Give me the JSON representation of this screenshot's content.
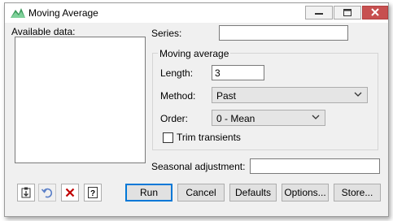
{
  "window": {
    "title": "Moving Average"
  },
  "available_data": {
    "label": "Available data:"
  },
  "series": {
    "label": "Series:",
    "value": ""
  },
  "moving_average": {
    "group_label": "Moving average",
    "length_label": "Length:",
    "length_value": "3",
    "method_label": "Method:",
    "method_value": "Past",
    "order_label": "Order:",
    "order_value": "0 - Mean",
    "trim_label": "Trim transients",
    "trim_checked": false
  },
  "seasonal": {
    "label": "Seasonal adjustment:",
    "value": ""
  },
  "buttons": {
    "run": "Run",
    "cancel": "Cancel",
    "defaults": "Defaults",
    "options": "Options...",
    "store": "Store..."
  },
  "icons": {
    "app": "moving-average-app-icon",
    "minimize": "minimize-icon",
    "maximize": "maximize-icon",
    "close": "close-icon",
    "copy": "clipboard-copy-icon",
    "undo": "undo-icon",
    "clear": "clear-x-icon",
    "help": "help-icon"
  },
  "colors": {
    "close_button": "#c75050",
    "default_button_border": "#0078d7",
    "undo_icon": "#5a7fc8",
    "clear_icon": "#c00000"
  }
}
